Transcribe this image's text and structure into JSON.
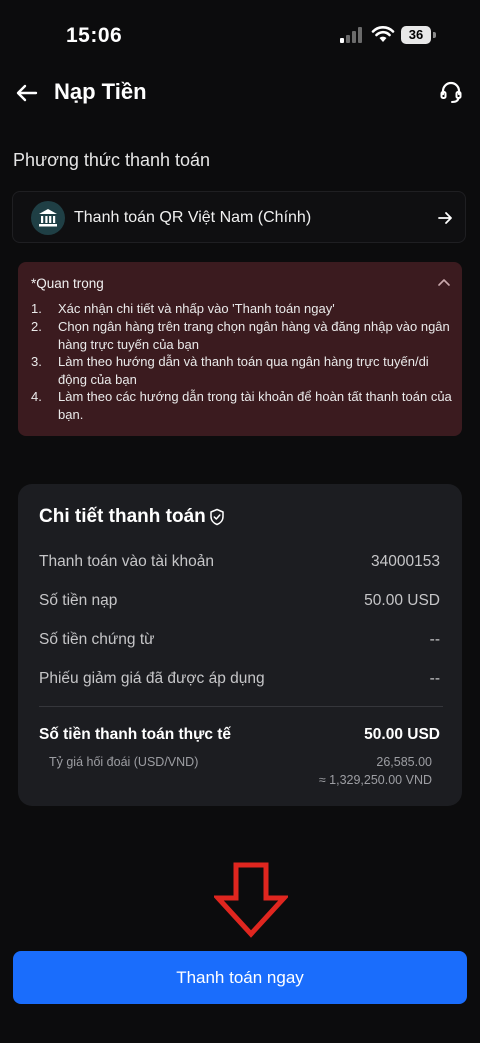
{
  "status_bar": {
    "time": "15:06",
    "battery": "36"
  },
  "header": {
    "title": "Nạp Tiền"
  },
  "payment_method": {
    "section_label": "Phương thức thanh toán",
    "method_name": "Thanh toán QR Việt Nam (Chính)"
  },
  "notice": {
    "title": "*Quan trọng",
    "items": [
      {
        "num": "1.",
        "text": "Xác nhận chi tiết và nhấp vào 'Thanh toán ngay'"
      },
      {
        "num": "2.",
        "text": "Chọn ngân hàng trên trang chọn ngân hàng và đăng nhập vào ngân hàng trực tuyến của bạn"
      },
      {
        "num": "3.",
        "text": "Làm theo hướng dẫn và thanh toán qua ngân hàng trực tuyến/di động của bạn"
      },
      {
        "num": "4.",
        "text": "Làm theo các hướng dẫn trong tài khoản để hoàn tất thanh toán của bạn."
      }
    ]
  },
  "details": {
    "title": "Chi tiết thanh toán",
    "rows": [
      {
        "label": "Thanh toán vào tài khoản",
        "value": "34000153"
      },
      {
        "label": "Số tiền nạp",
        "value": "50.00 USD"
      },
      {
        "label": "Số tiền chứng từ",
        "value": "--"
      },
      {
        "label": "Phiếu giảm giá đã được áp dụng",
        "value": "--"
      }
    ],
    "total_label": "Số tiền thanh toán thực tế",
    "total_value": "50.00 USD",
    "rate_label": "Tỷ giá hối đoái (USD/VND)",
    "rate_value": "26,585.00",
    "rate_vnd": "≈ 1,329,250.00 VND"
  },
  "pay_button": {
    "label": "Thanh toán ngay"
  },
  "colors": {
    "background": "#0c0c0d",
    "accent": "#1a6dfc",
    "notice_bg": "#3b1b1f",
    "card_bg": "#1c1d21",
    "annotation_arrow": "#e0261f"
  }
}
